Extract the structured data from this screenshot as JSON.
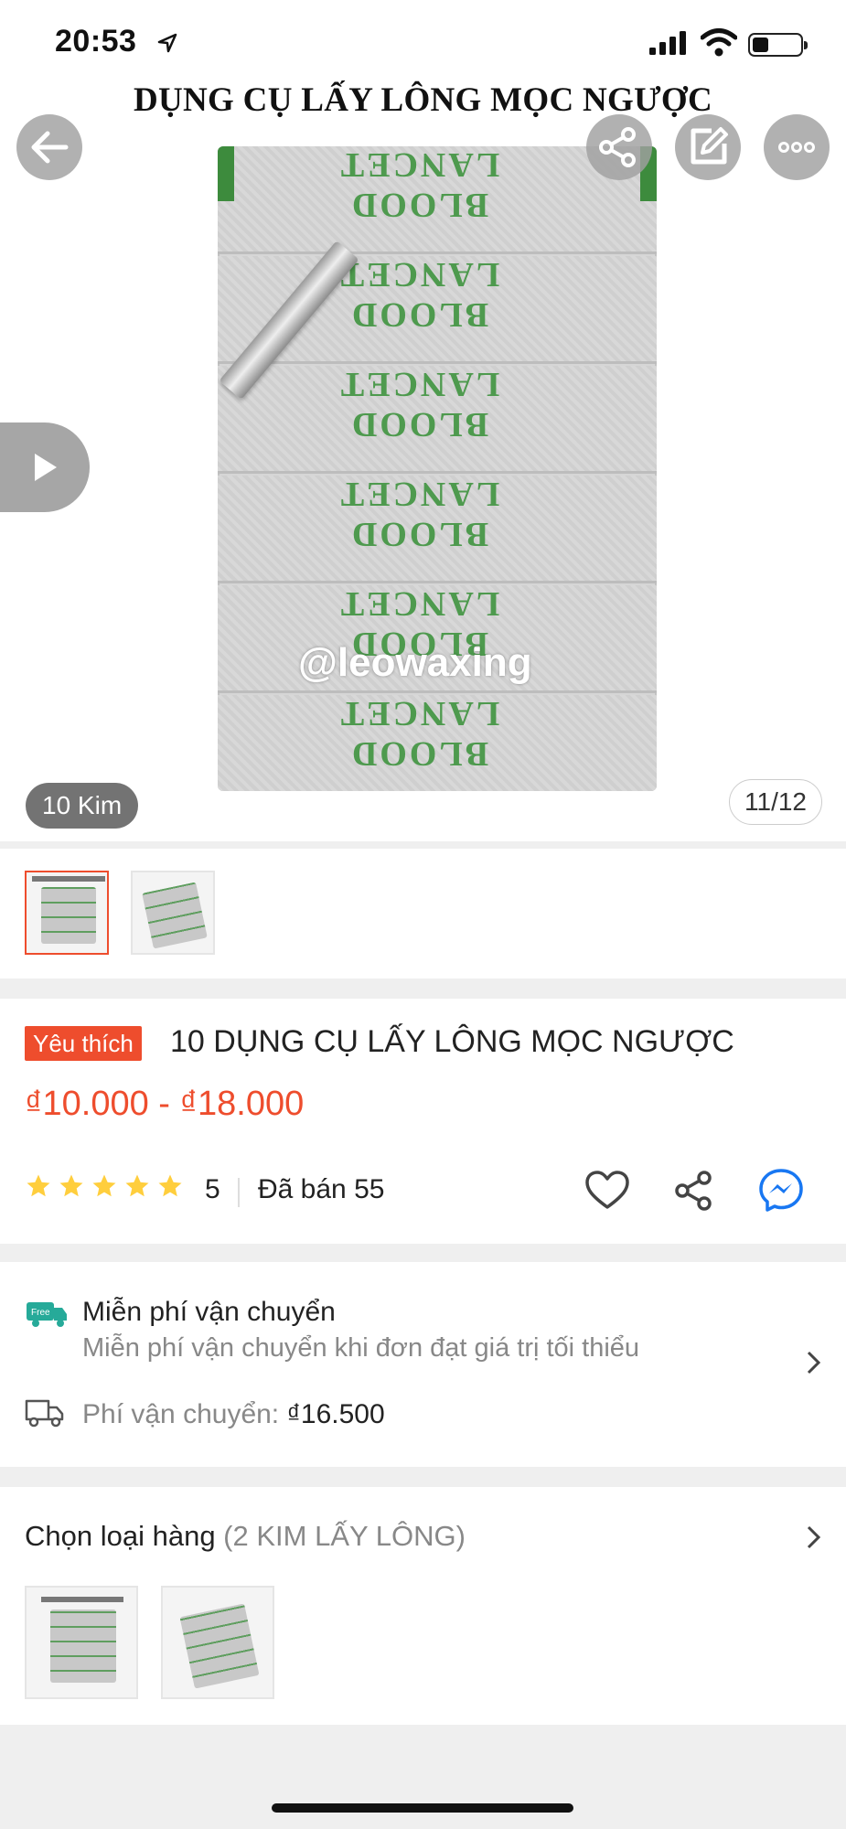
{
  "status_bar": {
    "time": "20:53"
  },
  "hero": {
    "image_title": "DỤNG CỤ LẤY LÔNG MỌC  NGƯỢC",
    "package_text": "BLOOD LANCET",
    "watermark": "@leowaxing",
    "variant_pill": "10 Kim",
    "image_counter": "11/12"
  },
  "product": {
    "badge": "Yêu thích",
    "title": "10 DỤNG CỤ LẤY LÔNG MỌC NGƯỢC",
    "price_range": "₫10.000 - ₫18.000",
    "rating_value": "5",
    "stars_count": 5,
    "sold": "Đã bán 55"
  },
  "shipping": {
    "free_title": "Miễn phí vận chuyển",
    "free_sub": "Miễn phí vận chuyển khi đơn đạt giá trị tối thiểu",
    "free_badge": "Free",
    "fee_label": "Phí vận chuyển: ",
    "fee_value": "₫16.500"
  },
  "variants": {
    "label": "Chọn loại hàng",
    "sub": " (2 KIM LẤY LÔNG)"
  },
  "colors": {
    "accent": "#ee4d2d",
    "star": "#ffce3d",
    "messenger": "#1877f2"
  }
}
